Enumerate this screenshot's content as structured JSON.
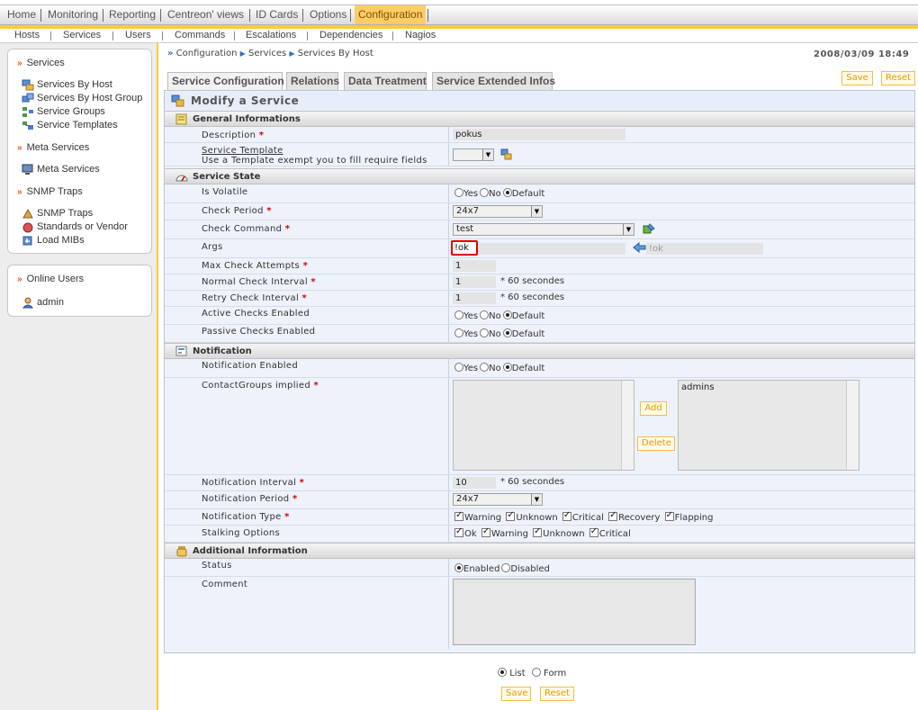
{
  "topmenu": {
    "tabs": [
      "Home",
      "Monitoring",
      "Reporting",
      "Centreon' views",
      "ID Cards",
      "Options",
      "Configuration"
    ],
    "active": "Configuration"
  },
  "submenu": [
    "Hosts",
    "Services",
    "Users",
    "Commands",
    "Escalations",
    "Dependencies",
    "Nagios"
  ],
  "sidebar": {
    "services_header": "Services",
    "services_items": [
      "Services By Host",
      "Services By Host Group",
      "Service Groups",
      "Service Templates"
    ],
    "meta_header": "Meta Services",
    "meta_items": [
      "Meta Services"
    ],
    "snmp_header": "SNMP Traps",
    "snmp_items": [
      "SNMP Traps",
      "Standards or Vendor",
      "Load MIBs"
    ],
    "online_header": "Online Users",
    "online_users": [
      "admin"
    ]
  },
  "breadcrumb": [
    "Configuration",
    "Services",
    "Services By Host"
  ],
  "datetime": "2008/03/09 18:49",
  "buttons": {
    "save": "Save",
    "reset": "Reset"
  },
  "form_tabs": [
    "Service Configuration",
    "Relations",
    "Data Treatment",
    "Service Extended Infos"
  ],
  "form_title": "Modify a Service",
  "sections": {
    "general": "General Informations",
    "state": "Service State",
    "notification": "Notification",
    "additional": "Additional Information"
  },
  "labels": {
    "description": "Description",
    "service_template": "Service Template",
    "template_hint": "Use a Template exempt you to fill require fields",
    "is_volatile": "Is Volatile",
    "check_period": "Check Period",
    "check_command": "Check Command",
    "args": "Args",
    "max_check_attempts": "Max Check Attempts",
    "normal_check_interval": "Normal Check Interval",
    "retry_check_interval": "Retry Check Interval",
    "active_checks": "Active Checks Enabled",
    "passive_checks": "Passive Checks Enabled",
    "notification_enabled": "Notification Enabled",
    "contactgroups": "ContactGroups implied",
    "notification_interval": "Notification Interval",
    "notification_period": "Notification Period",
    "notification_type": "Notification Type",
    "stalking_options": "Stalking Options",
    "status": "Status",
    "comment": "Comment"
  },
  "values": {
    "description": "pokus",
    "check_period": "24x7",
    "check_command": "test",
    "args": "!ok",
    "args_preview": "!ok",
    "max_check_attempts": "1",
    "normal_check_interval": "1",
    "retry_check_interval": "1",
    "interval_unit": "* 60 secondes",
    "notification_interval": "10",
    "notification_period": "24x7",
    "contactgroups_selected": [
      "admins"
    ]
  },
  "radio_labels": {
    "yes": "Yes",
    "no": "No",
    "default": "Default",
    "enabled": "Enabled",
    "disabled": "Disabled"
  },
  "notification_types": [
    "Warning",
    "Unknown",
    "Critical",
    "Recovery",
    "Flapping"
  ],
  "stalking_options": [
    "Ok",
    "Warning",
    "Unknown",
    "Critical"
  ],
  "list_buttons": {
    "add": "Add",
    "delete": "Delete"
  },
  "bottom": {
    "list": "List",
    "form": "Form"
  },
  "colors": {
    "accent": "#ffcc33",
    "highlight": "#e00000",
    "link_blue": "#2f6fbd"
  }
}
